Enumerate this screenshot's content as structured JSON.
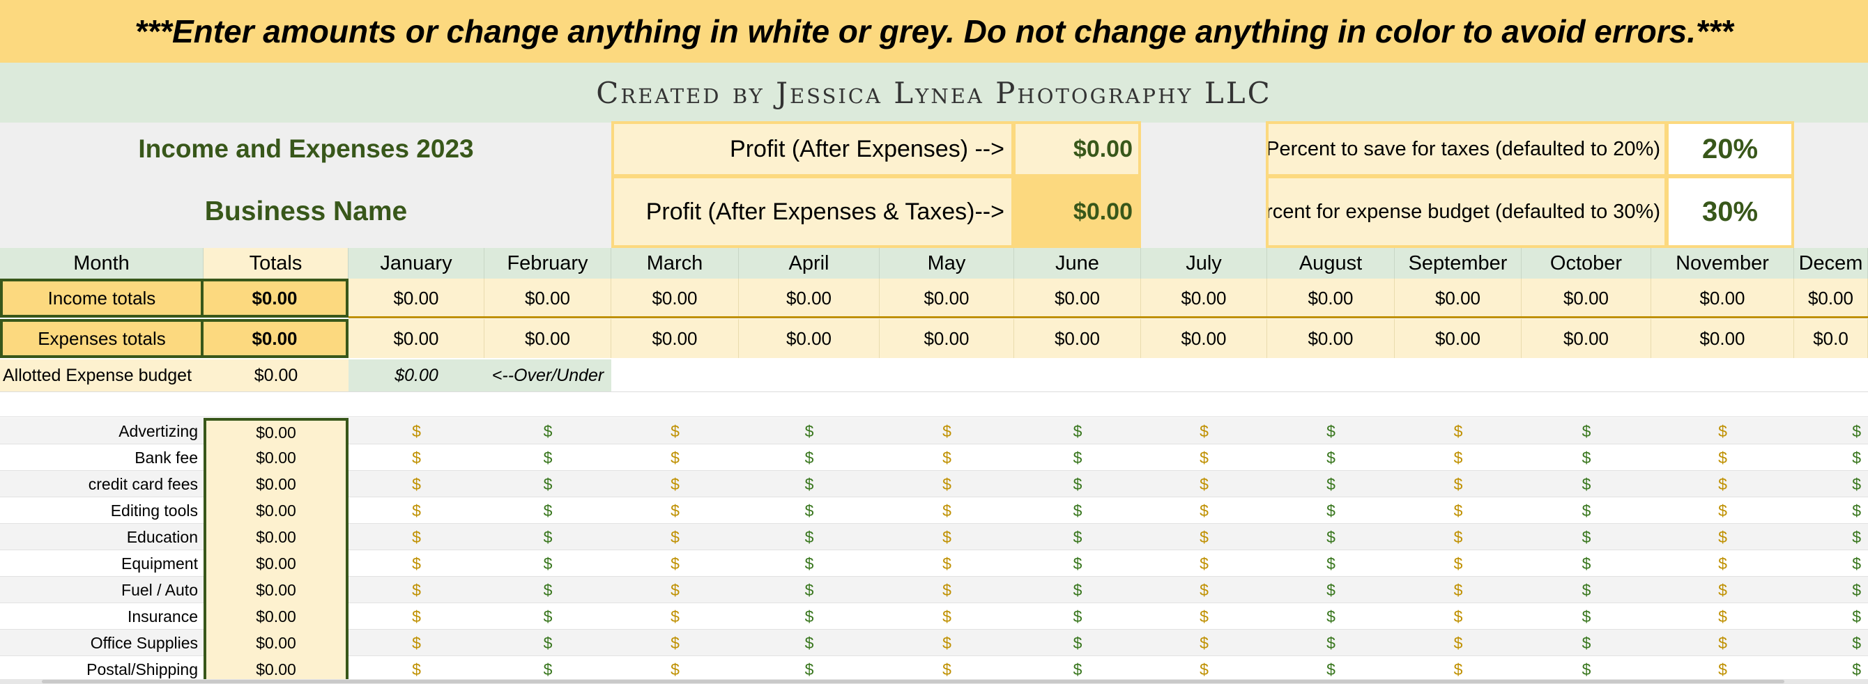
{
  "banner": "***Enter amounts or change anything in white or grey. Do not change anything in color to avoid errors.***",
  "credit": "Created by Jessica Lynea Photography LLC",
  "title": "Income and Expenses 2023",
  "business_name": "Business Name",
  "profit": {
    "after_expenses_label": "Profit (After Expenses) -->",
    "after_expenses_value": "$0.00",
    "after_taxes_label": "Profit (After Expenses & Taxes)-->",
    "after_taxes_value": "$0.00"
  },
  "settings": {
    "tax_label": "Percent to save for taxes (defaulted to 20%)",
    "tax_value": "20%",
    "budget_label": "rcent for expense budget (defaulted to 30%)",
    "budget_value": "30%"
  },
  "columns": [
    "Month",
    "Totals",
    "January",
    "February",
    "March",
    "April",
    "May",
    "June",
    "July",
    "August",
    "September",
    "October",
    "November",
    "Decem"
  ],
  "income_row": {
    "label": "Income totals",
    "total": "$0.00",
    "values": [
      "$0.00",
      "$0.00",
      "$0.00",
      "$0.00",
      "$0.00",
      "$0.00",
      "$0.00",
      "$0.00",
      "$0.00",
      "$0.00",
      "$0.00",
      "$0.00"
    ]
  },
  "expenses_row": {
    "label": "Expenses totals",
    "total": "$0.00",
    "values": [
      "$0.00",
      "$0.00",
      "$0.00",
      "$0.00",
      "$0.00",
      "$0.00",
      "$0.00",
      "$0.00",
      "$0.00",
      "$0.00",
      "$0.00",
      "$0.0"
    ]
  },
  "budget_row": {
    "label": "Allotted Expense budget",
    "total": "$0.00",
    "diff": "$0.00",
    "note": "<--Over/Under"
  },
  "expense_categories": [
    {
      "name": "Advertizing",
      "total": "$0.00"
    },
    {
      "name": "Bank fee",
      "total": "$0.00"
    },
    {
      "name": "credit card fees",
      "total": "$0.00"
    },
    {
      "name": "Editing tools",
      "total": "$0.00"
    },
    {
      "name": "Education",
      "total": "$0.00"
    },
    {
      "name": "Equipment",
      "total": "$0.00"
    },
    {
      "name": "Fuel / Auto",
      "total": "$0.00"
    },
    {
      "name": "Insurance",
      "total": "$0.00"
    },
    {
      "name": "Office Supplies",
      "total": "$0.00"
    },
    {
      "name": "Postal/Shipping",
      "total": "$0.00"
    }
  ],
  "currency_symbol": "$",
  "colors": {
    "banner": "#fcd97f",
    "credit": "#dceadb",
    "accent_green": "#38571a",
    "gold_dollar": "#bf9000",
    "green_dollar": "#38761d",
    "light_yellow": "#fdf1cf"
  }
}
